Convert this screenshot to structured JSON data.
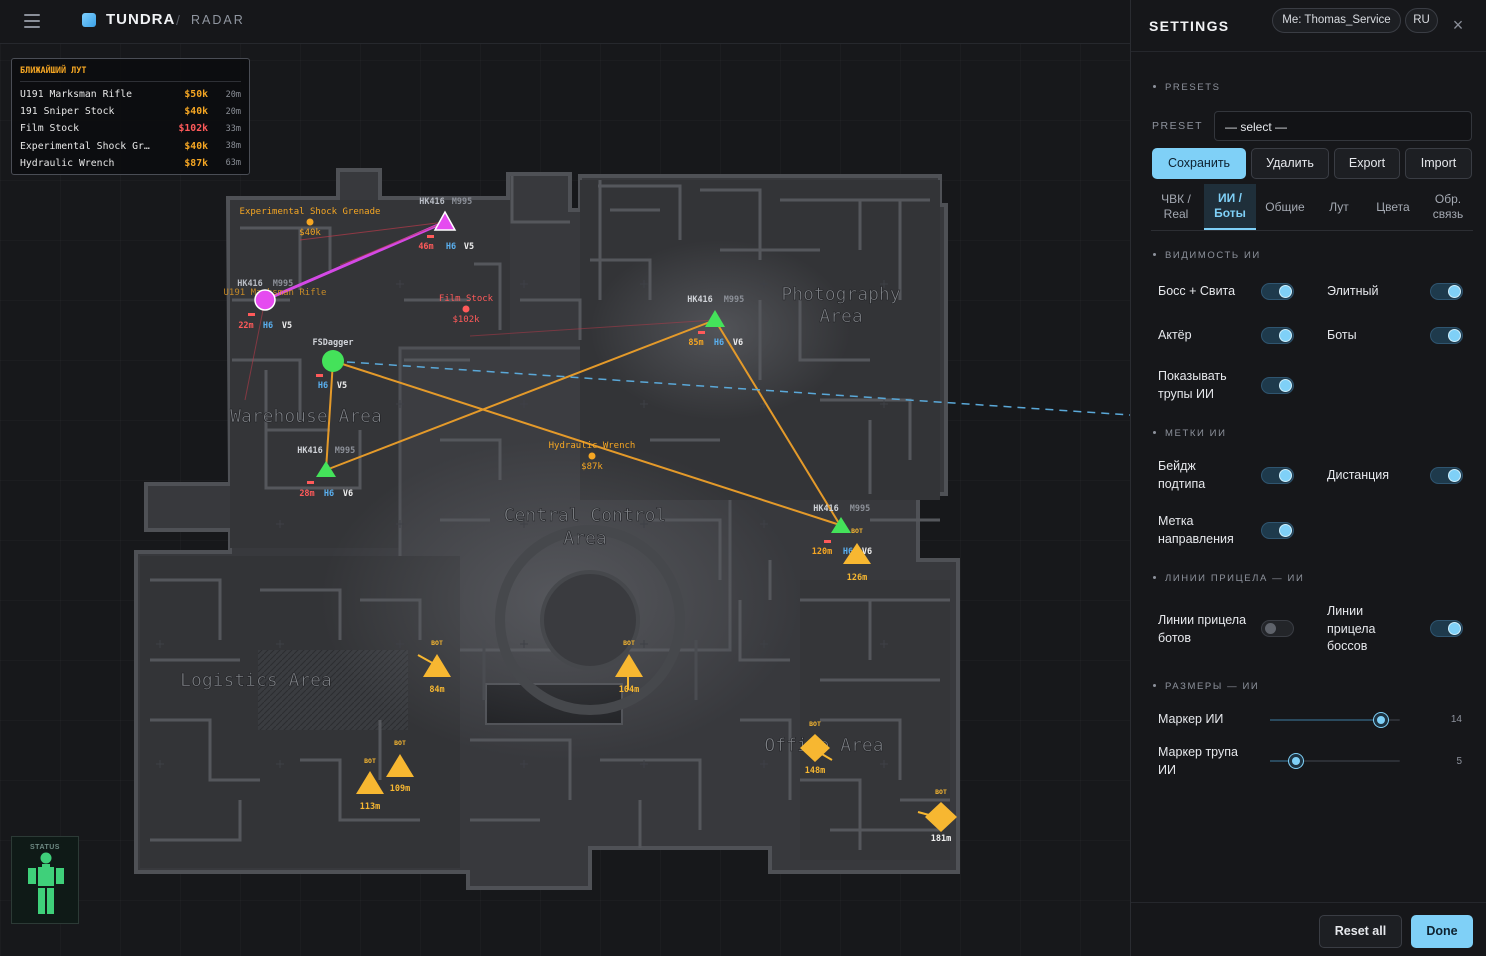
{
  "header": {
    "app_name": "TUNDRA",
    "separator": "/",
    "page": "RADAR"
  },
  "loot": {
    "title": "БЛИЖАЙШИЙ ЛУТ",
    "items": [
      {
        "name": "U191 Marksman Rifle",
        "price": "$50k",
        "dist": "20m",
        "color": "#f5a623"
      },
      {
        "name": "191 Sniper Stock",
        "price": "$40k",
        "dist": "20m",
        "color": "#f5a623"
      },
      {
        "name": "Film Stock",
        "price": "$102k",
        "dist": "33m",
        "color": "#ff5a5a"
      },
      {
        "name": "Experimental Shock Gr…",
        "price": "$40k",
        "dist": "38m",
        "color": "#f5a623"
      },
      {
        "name": "Hydraulic Wrench",
        "price": "$87k",
        "dist": "63m",
        "color": "#f5a623"
      }
    ]
  },
  "map": {
    "areas": [
      {
        "name": "Photography\nArea"
      },
      {
        "name": "Warehouse Area"
      },
      {
        "name": "Central Control\nArea"
      },
      {
        "name": "Logistics Area"
      },
      {
        "name": "Office Area"
      }
    ],
    "loot_labels": [
      {
        "name": "Experimental Shock Grenade",
        "price": "$40k",
        "color": "#f5a623"
      },
      {
        "name": "U191 Marksman Rifle",
        "price": "$50k",
        "color": "#f5a623"
      },
      {
        "name": "Film Stock",
        "price": "$102k",
        "color": "#ff5a5a"
      },
      {
        "name": "Hydraulic Wrench",
        "price": "$87k",
        "color": "#f5a623"
      }
    ],
    "players": [
      {
        "weapon": "HK416",
        "ammo": "M995",
        "dist": "46m",
        "helmet": "H6",
        "vest": "V5",
        "color": "#e54bf0",
        "shape": "triangle"
      },
      {
        "weapon": "HK416",
        "ammo": "M995",
        "dist": "22m",
        "helmet": "H6",
        "vest": "V5",
        "color": "#e54bf0",
        "shape": "circle"
      },
      {
        "weapon": "FSDagger",
        "ammo": "",
        "dist": "",
        "helmet": "H6",
        "vest": "V5",
        "color": "#44e25a",
        "shape": "circle"
      },
      {
        "weapon": "HK416",
        "ammo": "M995",
        "dist": "85m",
        "helmet": "H6",
        "vest": "V6",
        "color": "#44e25a",
        "shape": "triangle"
      },
      {
        "weapon": "HK416",
        "ammo": "M995",
        "dist": "28m",
        "helmet": "H6",
        "vest": "V6",
        "color": "#44e25a",
        "shape": "triangle"
      },
      {
        "weapon": "HK416",
        "ammo": "M995",
        "dist": "120m",
        "helmet": "H6",
        "vest": "V6",
        "color": "#44e25a",
        "shape": "triangle"
      }
    ],
    "bots": [
      {
        "tag": "BOT",
        "dist": "126m",
        "shape": "triangle"
      },
      {
        "tag": "BOT",
        "dist": "84m",
        "shape": "triangle"
      },
      {
        "tag": "BOT",
        "dist": "104m",
        "shape": "triangle"
      },
      {
        "tag": "BOT",
        "dist": "148m",
        "shape": "diamond"
      },
      {
        "tag": "BOT",
        "dist": "109m",
        "shape": "triangle"
      },
      {
        "tag": "BOT",
        "dist": "113m",
        "shape": "triangle"
      },
      {
        "tag": "BOT",
        "dist": "181m",
        "shape": "diamond"
      }
    ]
  },
  "status": {
    "label": "STATUS"
  },
  "settings": {
    "title": "SETTINGS",
    "user_chip": "Me: Thomas_Service",
    "lang_chip": "RU",
    "close_icon": "×",
    "presets": {
      "section": "PRESETS",
      "label": "PRESET",
      "select_value": "— select —",
      "buttons": [
        "Сохранить",
        "Удалить",
        "Export",
        "Import"
      ]
    },
    "tabs": [
      "ЧВК / Real",
      "ИИ / Боты",
      "Общие",
      "Лут",
      "Цвета",
      "Обр. связь"
    ],
    "active_tab": "ИИ / Боты",
    "sections": {
      "visibility": "ВИДИМОСТЬ ИИ",
      "labels": "МЕТКИ ИИ",
      "sightlines": "ЛИНИИ ПРИЦЕЛА — ИИ",
      "sizes": "РАЗМЕРЫ — ИИ"
    },
    "options": {
      "boss": {
        "label": "Босс + Свита",
        "on": true
      },
      "elite": {
        "label": "Элитный",
        "on": true
      },
      "actor": {
        "label": "Актёр",
        "on": true
      },
      "bots": {
        "label": "Боты",
        "on": true
      },
      "corpses": {
        "label": "Показывать трупы ИИ",
        "on": true
      },
      "subtype_badge": {
        "label": "Бейдж подтипа",
        "on": true
      },
      "distance": {
        "label": "Дистанция",
        "on": true
      },
      "direction": {
        "label": "Метка направления",
        "on": true
      },
      "bot_lines": {
        "label": "Линии прицела ботов",
        "on": false
      },
      "boss_lines": {
        "label": "Линии прицела боссов",
        "on": true
      }
    },
    "sliders": {
      "ai_marker": {
        "label": "Маркер ИИ",
        "value": "14",
        "fraction": 0.85
      },
      "ai_corpse": {
        "label": "Маркер трупа ИИ",
        "value": "5",
        "fraction": 0.2
      }
    },
    "footer": {
      "reset": "Reset all",
      "done": "Done"
    }
  },
  "colors": {
    "accent": "#7fd0f7",
    "loot_orange": "#f5a623",
    "loot_red": "#ff5a5a",
    "bot_yellow": "#f7b731",
    "player_green": "#44e25a",
    "boss_magenta": "#e54bf0"
  }
}
